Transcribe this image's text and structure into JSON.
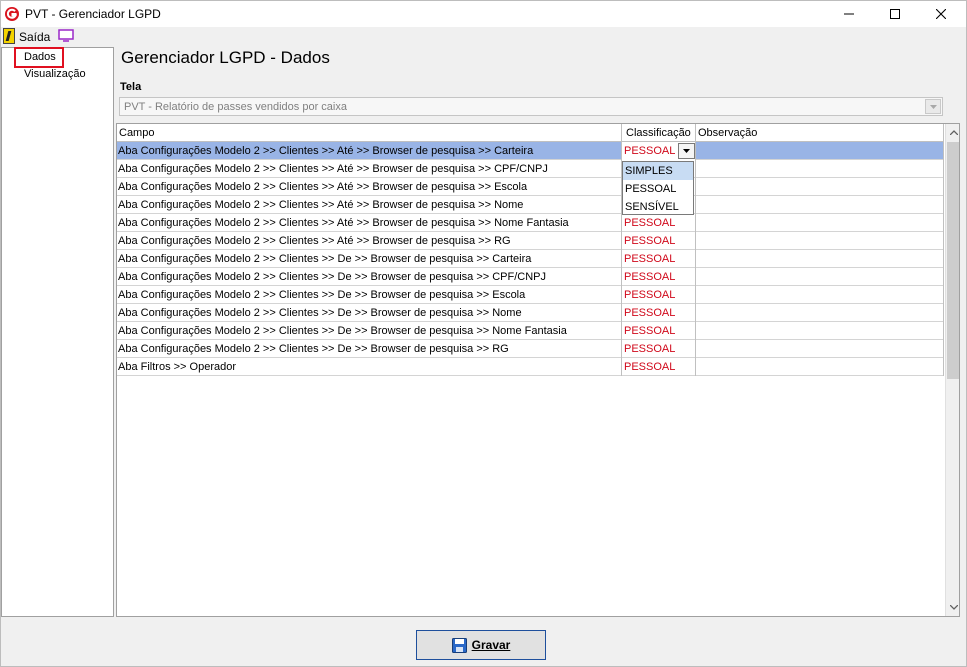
{
  "window": {
    "title": "PVT - Gerenciador LGPD"
  },
  "menu": {
    "exit_label": "Saída"
  },
  "sidebar": {
    "items": [
      {
        "label": "Dados",
        "selected": true
      },
      {
        "label": "Visualização",
        "selected": false
      }
    ]
  },
  "page": {
    "title": "Gerenciador LGPD - Dados"
  },
  "tela": {
    "label": "Tela",
    "value": "PVT - Relatório de passes vendidos por caixa"
  },
  "grid": {
    "columns": [
      "Campo",
      "Classificação",
      "Observação"
    ],
    "rows": [
      {
        "campo": "Aba Configurações Modelo 2 >> Clientes >> Até >> Browser de pesquisa >> Carteira",
        "classificacao": "PESSOAL",
        "observacao": ""
      },
      {
        "campo": "Aba Configurações Modelo 2 >> Clientes >> Até >> Browser de pesquisa >> CPF/CNPJ",
        "classificacao": "",
        "observacao": ""
      },
      {
        "campo": "Aba Configurações Modelo 2 >> Clientes >> Até >> Browser de pesquisa >> Escola",
        "classificacao": "",
        "observacao": ""
      },
      {
        "campo": "Aba Configurações Modelo 2 >> Clientes >> Até >> Browser de pesquisa >> Nome",
        "classificacao": "",
        "observacao": ""
      },
      {
        "campo": "Aba Configurações Modelo 2 >> Clientes >> Até >> Browser de pesquisa >> Nome Fantasia",
        "classificacao": "PESSOAL",
        "observacao": ""
      },
      {
        "campo": "Aba Configurações Modelo 2 >> Clientes >> Até >> Browser de pesquisa >> RG",
        "classificacao": "PESSOAL",
        "observacao": ""
      },
      {
        "campo": "Aba Configurações Modelo 2 >> Clientes >> De >> Browser de pesquisa >> Carteira",
        "classificacao": "PESSOAL",
        "observacao": ""
      },
      {
        "campo": "Aba Configurações Modelo 2 >> Clientes >> De >> Browser de pesquisa >> CPF/CNPJ",
        "classificacao": "PESSOAL",
        "observacao": ""
      },
      {
        "campo": "Aba Configurações Modelo 2 >> Clientes >> De >> Browser de pesquisa >> Escola",
        "classificacao": "PESSOAL",
        "observacao": ""
      },
      {
        "campo": "Aba Configurações Modelo 2 >> Clientes >> De >> Browser de pesquisa >> Nome",
        "classificacao": "PESSOAL",
        "observacao": ""
      },
      {
        "campo": "Aba Configurações Modelo 2 >> Clientes >> De >> Browser de pesquisa >> Nome Fantasia",
        "classificacao": "PESSOAL",
        "observacao": ""
      },
      {
        "campo": "Aba Configurações Modelo 2 >> Clientes >> De >> Browser de pesquisa >> RG",
        "classificacao": "PESSOAL",
        "observacao": ""
      },
      {
        "campo": "Aba Filtros >> Operador",
        "classificacao": "PESSOAL",
        "observacao": ""
      }
    ],
    "dropdown_options": [
      "SIMPLES",
      "PESSOAL",
      "SENSÍVEL"
    ]
  },
  "actions": {
    "save_label": "Gravar"
  },
  "colors": {
    "classification_text": "#d0081a",
    "selected_row": "#99b4e6",
    "highlight_box": "#e01020"
  }
}
